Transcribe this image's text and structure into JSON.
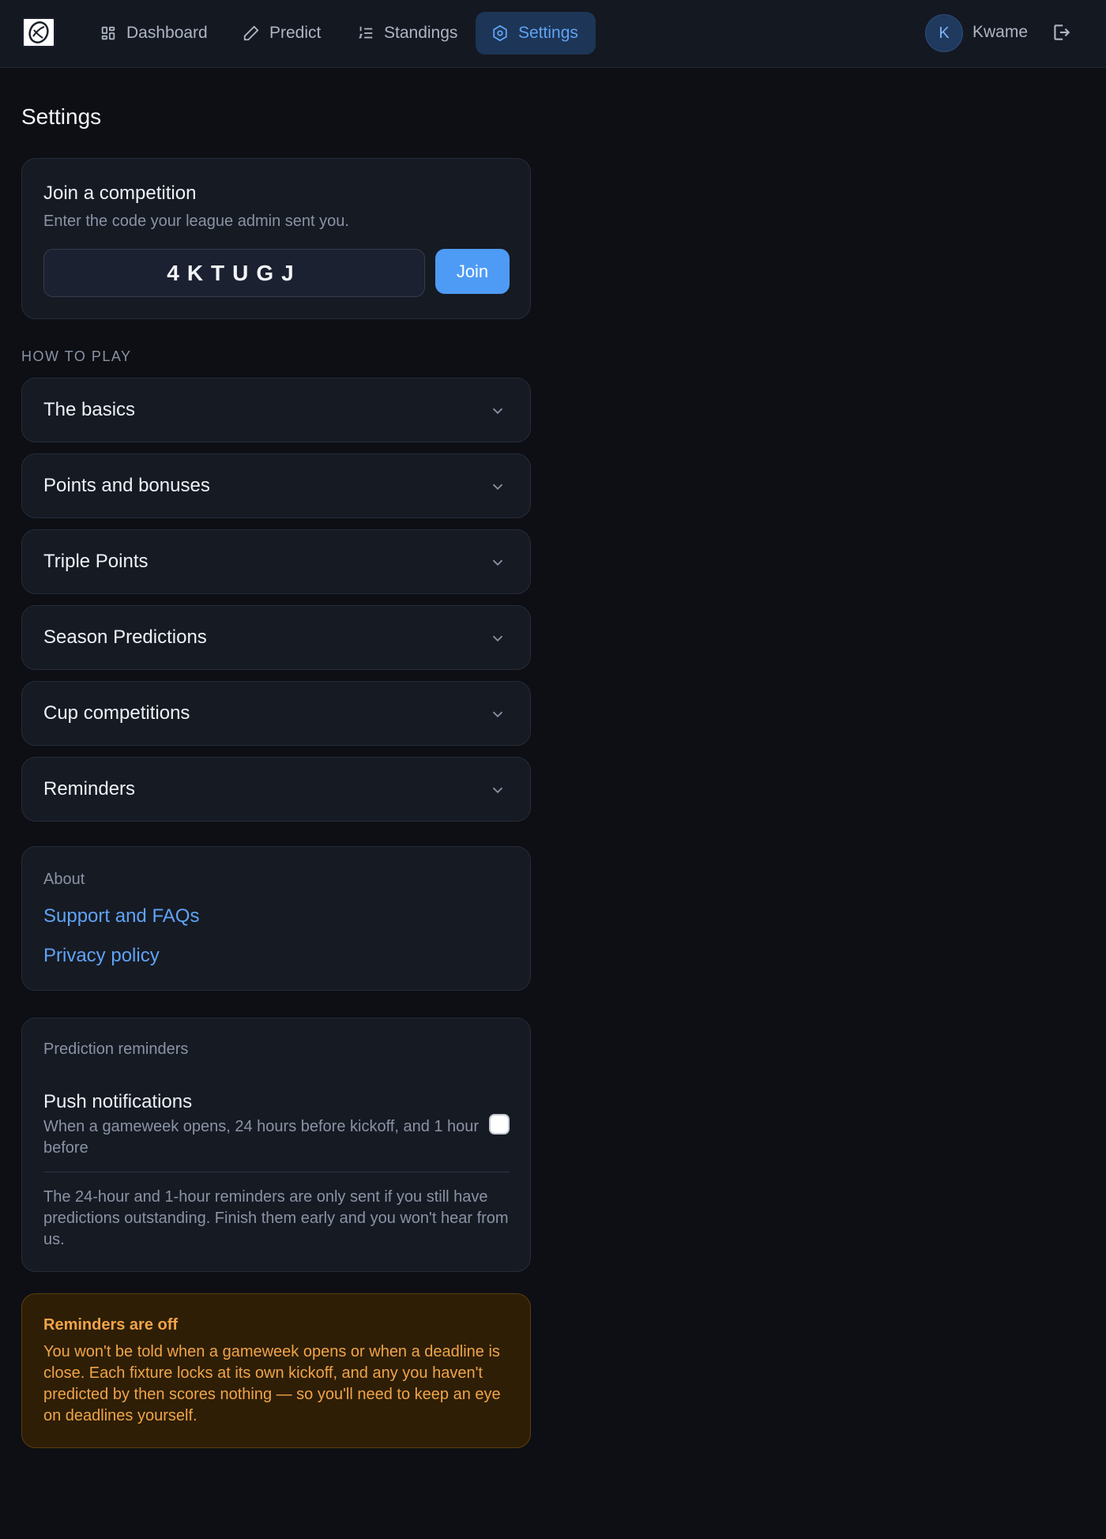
{
  "nav": {
    "items": [
      {
        "label": "Dashboard",
        "icon": "grid-icon"
      },
      {
        "label": "Predict",
        "icon": "pencil-icon"
      },
      {
        "label": "Standings",
        "icon": "list-ordered-icon"
      },
      {
        "label": "Settings",
        "icon": "settings-icon",
        "active": true
      }
    ],
    "user": {
      "initial": "K",
      "name": "Kwame"
    }
  },
  "page": {
    "title": "Settings"
  },
  "join": {
    "title": "Join a competition",
    "subtitle": "Enter the code your league admin sent you.",
    "code_value": "4KTUGJ",
    "button_label": "Join"
  },
  "how_to_play": {
    "label": "HOW TO PLAY",
    "items": [
      "The basics",
      "Points and bonuses",
      "Triple Points",
      "Season Predictions",
      "Cup competitions",
      "Reminders"
    ]
  },
  "about": {
    "title": "About",
    "links": [
      "Support and FAQs",
      "Privacy policy"
    ]
  },
  "reminders": {
    "title": "Prediction reminders",
    "push_title": "Push notifications",
    "push_desc": "When a gameweek opens, 24 hours before kickoff, and 1 hour before",
    "push_enabled": false,
    "note": "The 24-hour and 1-hour reminders are only sent if you still have predictions outstanding. Finish them early and you won't hear from us."
  },
  "warning": {
    "title": "Reminders are off",
    "body": "You won't be told when a gameweek opens or when a deadline is close. Each fixture locks at its own kickoff, and any you haven't predicted by then scores nothing — so you'll need to keep an eye on deadlines yourself."
  },
  "colors": {
    "accent": "#4e9bf5",
    "background": "#0d0f14",
    "card": "#161a23",
    "warning_bg": "#2e1e06",
    "warning_text": "#f0a44a"
  }
}
